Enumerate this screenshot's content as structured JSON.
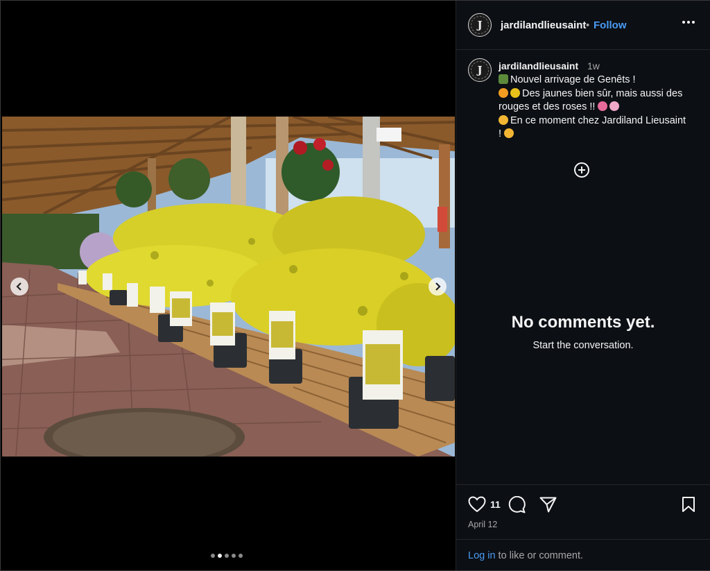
{
  "post": {
    "username": "jardilandlieusaint",
    "separator": "•",
    "follow_label": "Follow",
    "caption": {
      "username": "jardilandlieusaint",
      "time": "1w",
      "lines": [
        "Nouvel arrivage de Genêts !",
        "Des jaunes bien sûr, mais aussi des",
        "rouges et des roses !!",
        "En ce moment chez Jardiland Lieusaint",
        "!"
      ]
    },
    "empty": {
      "title": "No comments yet.",
      "subtitle": "Start the conversation."
    },
    "likes": "11",
    "date": "April 12",
    "login_link": "Log in",
    "login_rest": " to like or comment."
  },
  "carousel": {
    "total": 5,
    "active": 1
  },
  "icons": [
    "chevron-left-icon",
    "chevron-right-icon",
    "more-icon",
    "add-comment-icon",
    "heart-icon",
    "comment-icon",
    "share-icon",
    "bookmark-icon"
  ],
  "colors": {
    "link": "#4b9cf5",
    "panel": "#0c0f14",
    "muted": "#a8a8a8"
  }
}
